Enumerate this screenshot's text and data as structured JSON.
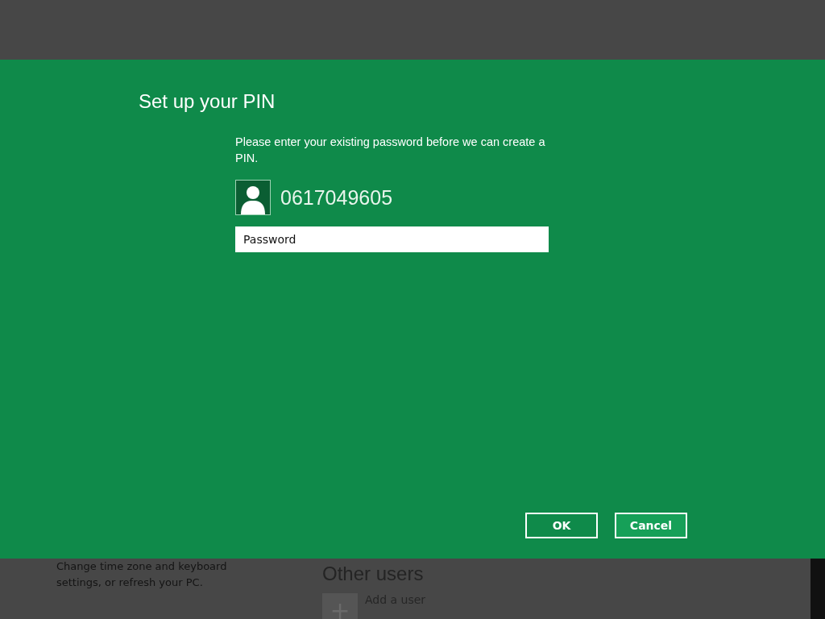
{
  "background": {
    "description": "Change time zone and keyboard settings, or refresh your PC.",
    "section_title": "Other users",
    "add_user": {
      "icon": "+",
      "label": "Add a user"
    }
  },
  "dialog": {
    "title": "Set up your PIN",
    "message": "Please enter your existing password before we can create a PIN.",
    "account": {
      "name": "0617049605"
    },
    "password_field": {
      "placeholder": "Password"
    },
    "buttons": [
      {
        "label": "OK"
      },
      {
        "label": "Cancel"
      }
    ]
  }
}
